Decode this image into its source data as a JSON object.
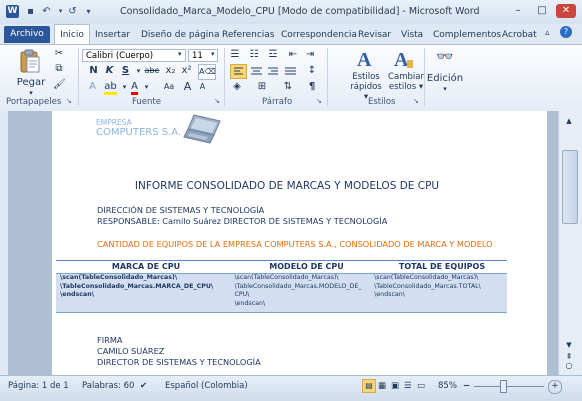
{
  "window": {
    "title": "Consolidado_Marca_Modelo_CPU [Modo de compatibilidad] - Microsoft Word",
    "app_icon": "W",
    "controls": [
      "–",
      "□",
      "✕"
    ]
  },
  "quick_access": {
    "save": "💾",
    "undo": "↶",
    "redo": "↺",
    "customize": "▾"
  },
  "tabs": [
    "Archivo",
    "Inicio",
    "Insertar",
    "Diseño de página",
    "Referencias",
    "Correspondencia",
    "Revisar",
    "Vista",
    "Complementos",
    "Acrobat"
  ],
  "ribbon": {
    "clipboard": {
      "paste_label": "Pegar",
      "group_label": "Portapapeles"
    },
    "font": {
      "family": "Calibri (Cuerpo)",
      "size": "11",
      "group_label": "Fuente",
      "bold": "N",
      "italic": "K",
      "underline": "S",
      "strike": "abe",
      "sub": "x₂",
      "sup": "x²",
      "grow": "A",
      "shrink": "A",
      "case": "Aa"
    },
    "paragraph": {
      "group_label": "Párrafo",
      "pilcrow": "¶"
    },
    "styles": {
      "quick_label": "Estilos rápidos",
      "quick_label_l1": "Estilos",
      "quick_label_l2": "rápidos ▾",
      "change_label_l1": "Cambiar",
      "change_label_l2": "estilos ▾",
      "group_label": "Estilos"
    },
    "editing": {
      "label": "Edición"
    }
  },
  "document": {
    "company_l1": "EMPRESA",
    "company_l2": "COMPUTERS S.A.",
    "report_title": "INFORME CONSOLIDADO DE MARCAS Y MODELOS DE CPU",
    "dept": "DIRECCIÓN DE SISTEMAS Y TECNOLOGÍA",
    "responsible": "RESPONSABLE: Camilo Suárez DIRECTOR DE SISTEMAS Y TECNOLOGÍA",
    "subtitle": "CANTIDAD DE EQUIPOS DE LA EMPRESA COMPUTERS S.A., CONSOLIDADO DE MARCA Y MODELO",
    "table": {
      "headers": [
        "MARCA DE CPU",
        "MODELO DE CPU",
        "TOTAL DE EQUIPOS"
      ],
      "cells": [
        [
          "\\scan(TableConsolidado_Marcas)\\",
          "\\TableConsolidado_Marcas.MARCA_DE_CPU\\",
          "\\endscan\\"
        ],
        [
          "\\scan(TableConsolidado_Marcas)\\",
          "\\TableConsolidado_Marcas.MODELO_DE_",
          "CPU\\",
          "\\endscan\\"
        ],
        [
          "\\scan(TableConsolidado_Marcas)\\",
          "\\TableConsolidado_Marcas.TOTAL\\",
          "\\endscan\\"
        ]
      ]
    },
    "signature": {
      "label": "FIRMA",
      "name": "CAMILO SUÁREZ",
      "role": "DIRECTOR DE SISTEMAS Y TECNOLOGÍA"
    }
  },
  "statusbar": {
    "page": "Página: 1 de 1",
    "words": "Palabras: 60",
    "language": "Español (Colombia)",
    "zoom": "85%",
    "zoom_value": 85
  },
  "colors": {
    "accent": "#2b579a",
    "orange": "#e36c0a",
    "doc_blue": "#1f3864",
    "table_band": "#d3dff0"
  }
}
